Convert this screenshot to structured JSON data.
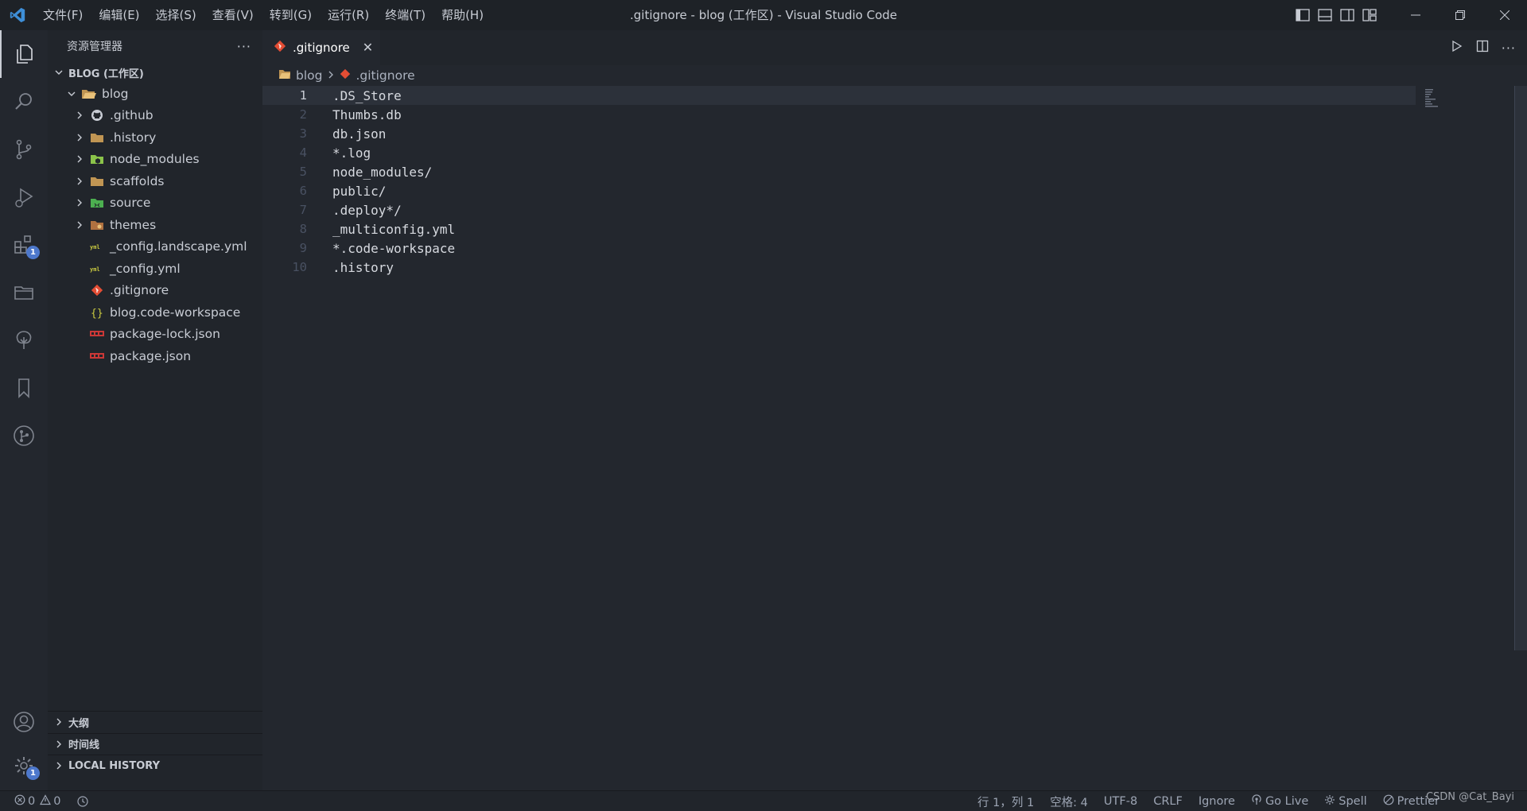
{
  "titlebar": {
    "window_title": ".gitignore - blog (工作区) - Visual Studio Code",
    "menu": [
      "文件(F)",
      "编辑(E)",
      "选择(S)",
      "查看(V)",
      "转到(G)",
      "运行(R)",
      "终端(T)",
      "帮助(H)"
    ]
  },
  "activitybar": {
    "extensions_badge": "1",
    "settings_badge": "1"
  },
  "sidebar": {
    "title": "资源管理器",
    "workspace": "BLOG (工作区)",
    "root": "blog",
    "items": [
      {
        "label": ".github",
        "kind": "folder",
        "icon": "github-folder-icon"
      },
      {
        "label": ".history",
        "kind": "folder",
        "icon": "folder-icon"
      },
      {
        "label": "node_modules",
        "kind": "folder",
        "icon": "node-folder-icon"
      },
      {
        "label": "scaffolds",
        "kind": "folder",
        "icon": "folder-icon"
      },
      {
        "label": "source",
        "kind": "folder",
        "icon": "source-folder-icon"
      },
      {
        "label": "themes",
        "kind": "folder",
        "icon": "themes-folder-icon"
      },
      {
        "label": "_config.landscape.yml",
        "kind": "file",
        "icon": "yaml-icon"
      },
      {
        "label": "_config.yml",
        "kind": "file",
        "icon": "yaml-icon"
      },
      {
        "label": ".gitignore",
        "kind": "file",
        "icon": "git-icon"
      },
      {
        "label": "blog.code-workspace",
        "kind": "file",
        "icon": "json-braces-icon"
      },
      {
        "label": "package-lock.json",
        "kind": "file",
        "icon": "npm-icon"
      },
      {
        "label": "package.json",
        "kind": "file",
        "icon": "npm-icon"
      }
    ],
    "sections": [
      "大纲",
      "时间线",
      "LOCAL HISTORY"
    ]
  },
  "editor": {
    "tab_label": ".gitignore",
    "breadcrumbs": [
      "blog",
      ".gitignore"
    ],
    "lines": [
      ".DS_Store",
      "Thumbs.db",
      "db.json",
      "*.log",
      "node_modules/",
      "public/",
      ".deploy*/",
      "_multiconfig.yml",
      "*.code-workspace",
      ".history"
    ],
    "line_numbers": [
      "1",
      "2",
      "3",
      "4",
      "5",
      "6",
      "7",
      "8",
      "9",
      "10"
    ]
  },
  "statusbar": {
    "errors": "0",
    "warnings": "0",
    "position": "行 1，列 1",
    "spaces": "空格: 4",
    "encoding": "UTF-8",
    "eol": "CRLF",
    "language": "Ignore",
    "go_live": "Go Live",
    "spell": "Spell",
    "prettier": "Prettier"
  },
  "watermark": "CSDN @Cat_Bayi",
  "colors": {
    "accent": "#4d78cc",
    "git_icon": "#e44d34",
    "yaml_icon": "#cbcb41"
  }
}
